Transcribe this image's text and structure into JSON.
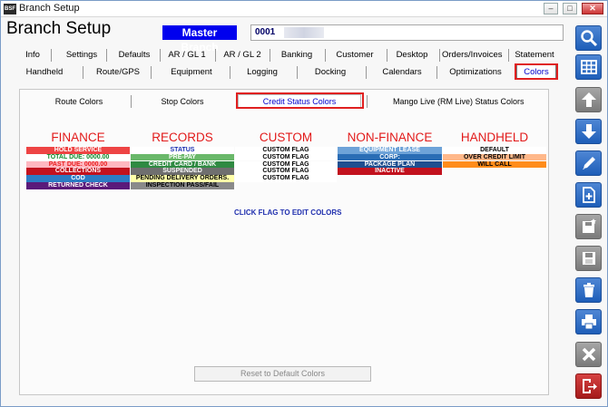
{
  "window": {
    "title": "Branch Setup",
    "app_badge": "BSF"
  },
  "header": {
    "title": "Branch Setup",
    "branch_name": "Master Branch",
    "branch_code": "0001"
  },
  "tabs_row1": [
    "Info",
    "Settings",
    "Defaults",
    "AR / GL 1",
    "AR / GL 2",
    "Banking",
    "Customer",
    "Desktop",
    "Orders/Invoices",
    "Statement"
  ],
  "tabs_row2": [
    "Handheld",
    "Route/GPS",
    "Equipment",
    "Logging",
    "Docking",
    "Calendars",
    "Optimizations",
    "Colors"
  ],
  "active_tab": "Colors",
  "sub_tabs": [
    "Route Colors",
    "Stop Colors",
    "Credit Status Colors",
    "Mango Live (RM Live) Status Colors"
  ],
  "active_sub_tab": "Credit Status Colors",
  "columns": {
    "finance": {
      "title": "FINANCE",
      "flags": [
        {
          "label": "HOLD SERVICE",
          "bg": "#ee4444",
          "fg": "#ffffff"
        },
        {
          "label": "TOTAL DUE: 0000.00",
          "bg": "#ffffff",
          "fg": "#0e8a2a"
        },
        {
          "label": "PAST DUE: 0000.00",
          "bg": "#ffb7c0",
          "fg": "#e81c1c"
        },
        {
          "label": "COLLECTIONS",
          "bg": "#c2121e",
          "fg": "#ffffff"
        },
        {
          "label": "COD",
          "bg": "#2c7cc4",
          "fg": "#ffffff"
        },
        {
          "label": "RETURNED CHECK",
          "bg": "#5a1a7a",
          "fg": "#ffffff"
        }
      ]
    },
    "records": {
      "title": "RECORDS",
      "flags": [
        {
          "label": "STATUS",
          "bg": "#ffffff",
          "fg": "#1a2fb0"
        },
        {
          "label": "PRE-PAY",
          "bg": "#6ab86a",
          "fg": "#ffffff"
        },
        {
          "label": "CREDIT CARD / BANK",
          "bg": "#2f8a42",
          "fg": "#ffffff"
        },
        {
          "label": "SUSPENDED",
          "bg": "#6f6f6f",
          "fg": "#ffffff"
        },
        {
          "label": "PENDING DELIVERY ORDERS.",
          "bg": "#ffffa8",
          "fg": "#000000"
        },
        {
          "label": "INSPECTION PASS/FAIL",
          "bg": "#8a8a8a",
          "fg": "#000000"
        }
      ]
    },
    "custom": {
      "title": "CUSTOM",
      "flags": [
        {
          "label": "CUSTOM FLAG",
          "bg": "#ffffff",
          "fg": "#000000"
        },
        {
          "label": "CUSTOM FLAG",
          "bg": "#ffffff",
          "fg": "#000000"
        },
        {
          "label": "CUSTOM FLAG",
          "bg": "#ffffff",
          "fg": "#000000"
        },
        {
          "label": "CUSTOM FLAG",
          "bg": "#ffffff",
          "fg": "#000000"
        },
        {
          "label": "CUSTOM FLAG",
          "bg": "#ffffff",
          "fg": "#000000"
        }
      ]
    },
    "non_finance": {
      "title": "NON-FINANCE",
      "flags": [
        {
          "label": "EQUIPMENT LEASE",
          "bg": "#6ea3d8",
          "fg": "#ffffff"
        },
        {
          "label": "CORP:",
          "bg": "#2a6db5",
          "fg": "#ffffff"
        },
        {
          "label": "PACKAGE PLAN",
          "bg": "#1f4f90",
          "fg": "#ffffff"
        },
        {
          "label": "INACTIVE",
          "bg": "#c2121e",
          "fg": "#ffffff"
        }
      ]
    },
    "handheld": {
      "title": "HANDHELD",
      "flags": [
        {
          "label": "DEFAULT",
          "bg": "#ffffff",
          "fg": "#000000"
        },
        {
          "label": "OVER CREDIT LIMIT",
          "bg": "#ffb88a",
          "fg": "#000000"
        },
        {
          "label": "WILL CALL",
          "bg": "#ff8c1a",
          "fg": "#000000"
        }
      ]
    }
  },
  "hint": "CLICK FLAG TO EDIT COLORS",
  "reset_button": "Reset to Default Colors",
  "sidebar_buttons": [
    "search-icon",
    "grid-icon",
    "arrow-up-icon",
    "arrow-down-icon",
    "pencil-icon",
    "new-document-icon",
    "save-as-icon",
    "save-icon",
    "trash-icon",
    "print-icon",
    "close-icon",
    "exit-icon"
  ]
}
